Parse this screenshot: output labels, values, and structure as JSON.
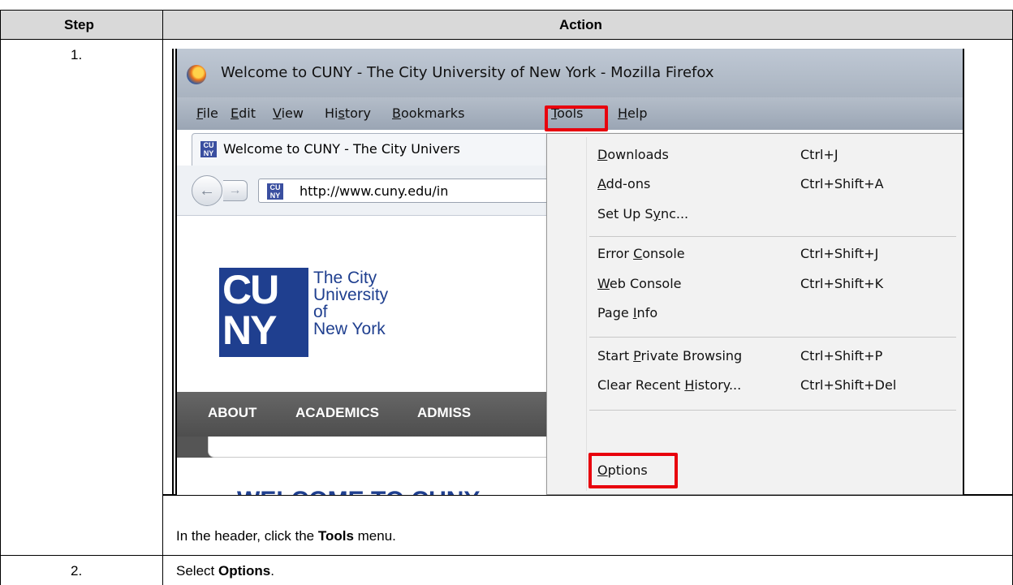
{
  "table": {
    "header_step": "Step",
    "header_action": "Action",
    "rows": [
      {
        "step": "1.",
        "instruction_prefix": "In the header, click the ",
        "instruction_bold": "Tools",
        "instruction_suffix": " menu."
      },
      {
        "step": "2.",
        "instruction_prefix": "Select ",
        "instruction_bold": "Options",
        "instruction_suffix": "."
      }
    ]
  },
  "browser": {
    "window_title": "Welcome to CUNY - The City University of New York - Mozilla Firefox",
    "menubar": [
      {
        "pre": "",
        "ul": "F",
        "post": "ile"
      },
      {
        "pre": "",
        "ul": "E",
        "post": "dit"
      },
      {
        "pre": "",
        "ul": "V",
        "post": "iew"
      },
      {
        "pre": "Hi",
        "ul": "s",
        "post": "tory"
      },
      {
        "pre": "",
        "ul": "B",
        "post": "ookmarks"
      },
      {
        "pre": "",
        "ul": "T",
        "post": "ools"
      },
      {
        "pre": "",
        "ul": "H",
        "post": "elp"
      }
    ],
    "tab_title": "Welcome to CUNY - The City Univers",
    "url": "http://www.cuny.edu/in",
    "favicon_text": [
      "CU",
      "NY"
    ],
    "accent_color": "#e8000d"
  },
  "page": {
    "logo_letters": [
      "CU",
      "NY"
    ],
    "logo_name": [
      "The City",
      "University",
      "of",
      "New York"
    ],
    "nav": [
      "ABOUT",
      "ACADEMICS",
      "ADMISS"
    ],
    "welcome": "WELCOME TO CUNY",
    "brand_color": "#1f3f8f"
  },
  "tools_menu": [
    {
      "pre": "",
      "ul": "D",
      "post": "ownloads",
      "shortcut": "Ctrl+J"
    },
    {
      "pre": "",
      "ul": "A",
      "post": "dd-ons",
      "shortcut": "Ctrl+Shift+A"
    },
    {
      "pre": "Set Up S",
      "ul": "y",
      "post": "nc...",
      "shortcut": ""
    },
    {
      "pre": "Error ",
      "ul": "C",
      "post": "onsole",
      "shortcut": "Ctrl+Shift+J"
    },
    {
      "pre": "",
      "ul": "W",
      "post": "eb Console",
      "shortcut": "Ctrl+Shift+K"
    },
    {
      "pre": "Page ",
      "ul": "I",
      "post": "nfo",
      "shortcut": ""
    },
    {
      "pre": "Start ",
      "ul": "P",
      "post": "rivate Browsing",
      "shortcut": "Ctrl+Shift+P"
    },
    {
      "pre": "Clear Recent ",
      "ul": "H",
      "post": "istory...",
      "shortcut": "Ctrl+Shift+Del"
    },
    {
      "pre": "",
      "ul": "O",
      "post": "ptions",
      "shortcut": ""
    }
  ]
}
